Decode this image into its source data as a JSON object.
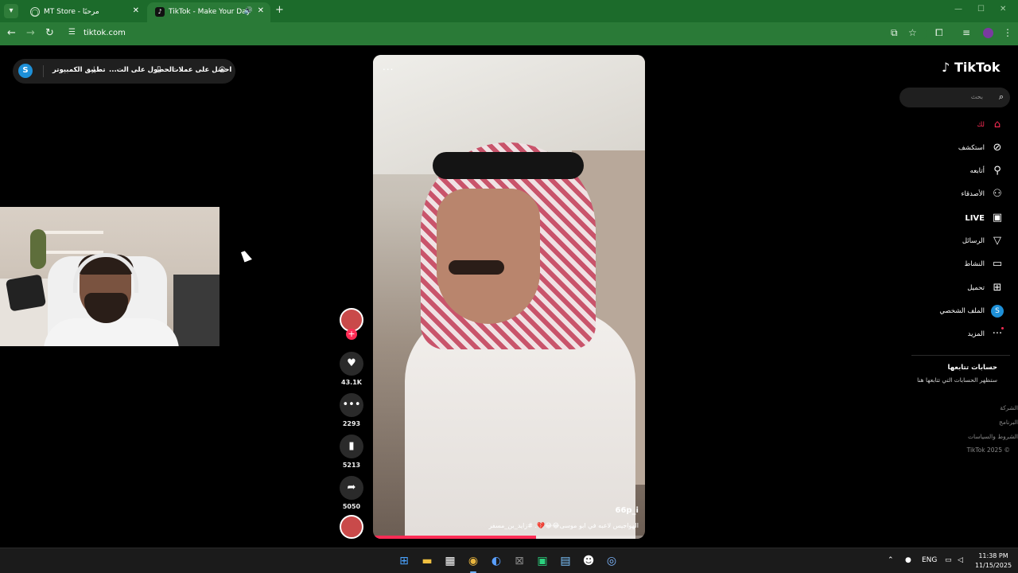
{
  "browser": {
    "tabs": [
      {
        "title": "MT Store - مرحبًا",
        "favicon": "globe-icon"
      },
      {
        "title": "TikTok - Make Your Day",
        "favicon": "tiktok-icon",
        "active": true,
        "audio": true
      }
    ],
    "url": "tiktok.com"
  },
  "top_pill": {
    "avatar_letter": "S",
    "items": [
      {
        "label": "احصل على عملات",
        "icon": "coin-icon"
      },
      {
        "label": "الحصول على الت...",
        "icon": "phone-icon"
      },
      {
        "label": "تطبيق الكمبيوتر",
        "icon": "download-icon"
      }
    ]
  },
  "video": {
    "menu": "...",
    "author": "66p_i",
    "caption": "الهواجيس لاعبه في ابو موسى😂😂💔. #زايد_بن_مسفر",
    "progress": 0.6
  },
  "actions": {
    "likes": "43.1K",
    "comments": "2293",
    "saves": "5213",
    "shares": "5050"
  },
  "sidebar": {
    "logo": "TikTok",
    "search_placeholder": "بحث",
    "nav": [
      {
        "label": "لك",
        "icon": "home-icon",
        "active": true
      },
      {
        "label": "استكشف",
        "icon": "compass-icon"
      },
      {
        "label": "أتابعه",
        "icon": "following-icon"
      },
      {
        "label": "الأصدقاء",
        "icon": "friends-icon"
      },
      {
        "label": "LIVE",
        "icon": "live-icon"
      },
      {
        "label": "الرسائل",
        "icon": "send-icon"
      },
      {
        "label": "النشاط",
        "icon": "message-icon"
      },
      {
        "label": "تحميل",
        "icon": "upload-icon"
      },
      {
        "label": "الملف الشخصي",
        "icon": "profile-icon",
        "avatar_letter": "S"
      },
      {
        "label": "المزيد",
        "icon": "more-icon"
      }
    ],
    "following_title": "حسابات تتابعها",
    "following_sub": "ستظهر الحسابات التي تتابعها هنا",
    "footer": [
      "الشركة",
      "البرنامج",
      "الشروط والسياسات",
      "© 2025 TikTok"
    ]
  },
  "taskbar": {
    "lang": "ENG",
    "time": "11:38 PM",
    "date": "11/15/2025"
  },
  "colors": {
    "accent": "#fe2c55",
    "browser_frame": "#1c6b2b"
  }
}
